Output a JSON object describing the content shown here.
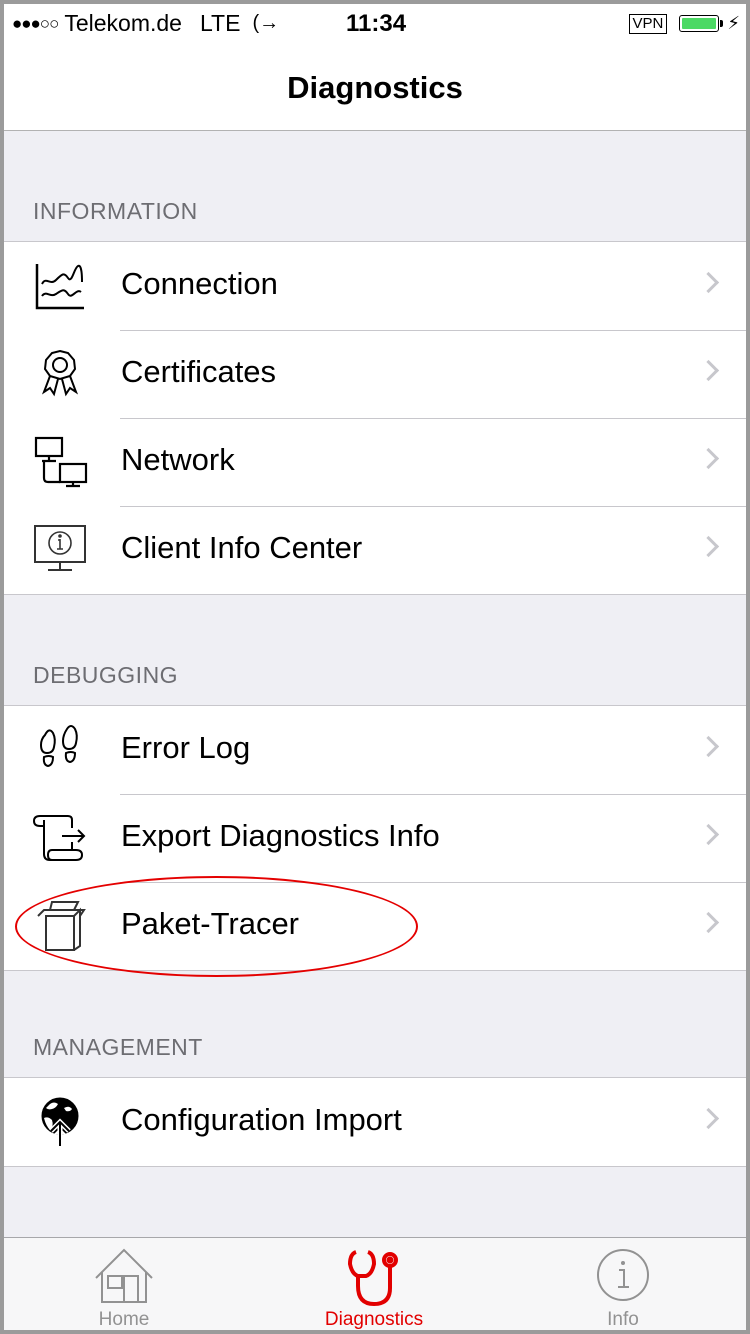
{
  "status_bar": {
    "signal": "●●●○○",
    "carrier": "Telekom.de",
    "network": "LTE",
    "call_icon": "call-forward-icon",
    "time": "11:34",
    "vpn": "VPN",
    "battery_icon": "battery-icon",
    "charging_icon": "bolt-icon"
  },
  "nav": {
    "title": "Diagnostics"
  },
  "sections": [
    {
      "header": "INFORMATION",
      "items": [
        {
          "label": "Connection",
          "icon": "chart-icon"
        },
        {
          "label": "Certificates",
          "icon": "certificate-icon"
        },
        {
          "label": "Network",
          "icon": "network-icon"
        },
        {
          "label": "Client Info Center",
          "icon": "monitor-info-icon"
        }
      ]
    },
    {
      "header": "DEBUGGING",
      "items": [
        {
          "label": "Error Log",
          "icon": "footprints-icon"
        },
        {
          "label": "Export Diagnostics Info",
          "icon": "scroll-export-icon"
        },
        {
          "label": "Paket-Tracer",
          "icon": "box-icon"
        }
      ]
    },
    {
      "header": "MANAGEMENT",
      "items": [
        {
          "label": "Configuration Import",
          "icon": "globe-import-icon"
        }
      ]
    }
  ],
  "tabbar": {
    "tabs": [
      {
        "label": "Home",
        "icon": "home-icon",
        "active": false
      },
      {
        "label": "Diagnostics",
        "icon": "stethoscope-icon",
        "active": true
      },
      {
        "label": "Info",
        "icon": "info-icon",
        "active": false
      }
    ],
    "active_color": "#e20000",
    "inactive_color": "#929292"
  },
  "annotation": {
    "color": "#e40000",
    "target": "Paket-Tracer"
  }
}
